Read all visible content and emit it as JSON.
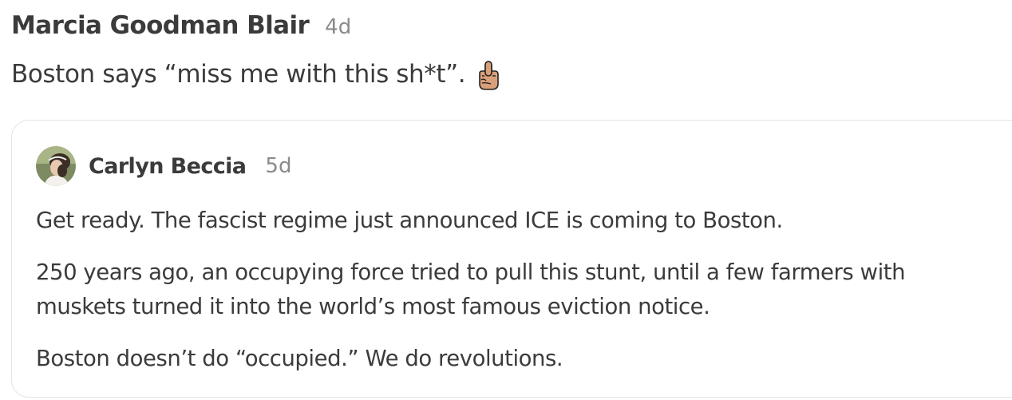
{
  "post": {
    "author": "Marcia Goodman Blair",
    "time": "4d",
    "text": "Boston says “miss me with this sh*t”.",
    "emoji": "middle-finger-icon"
  },
  "quoted_post": {
    "author": "Carlyn Beccia",
    "time": "5d",
    "avatar": "avatar-photo",
    "paragraphs": [
      "Get ready. The fascist regime just announced ICE is coming to Boston.",
      "250 years ago, an occupying force tried to pull this stunt, until a few farmers with muskets turned it into the world’s most famous eviction notice.",
      "Boston doesn’t do “occupied.” We do revolutions."
    ]
  },
  "colors": {
    "text": "#3b3b3b",
    "muted": "#8a8a8a",
    "border": "#e2e2e2",
    "emoji_skin": "#d9a07a"
  }
}
